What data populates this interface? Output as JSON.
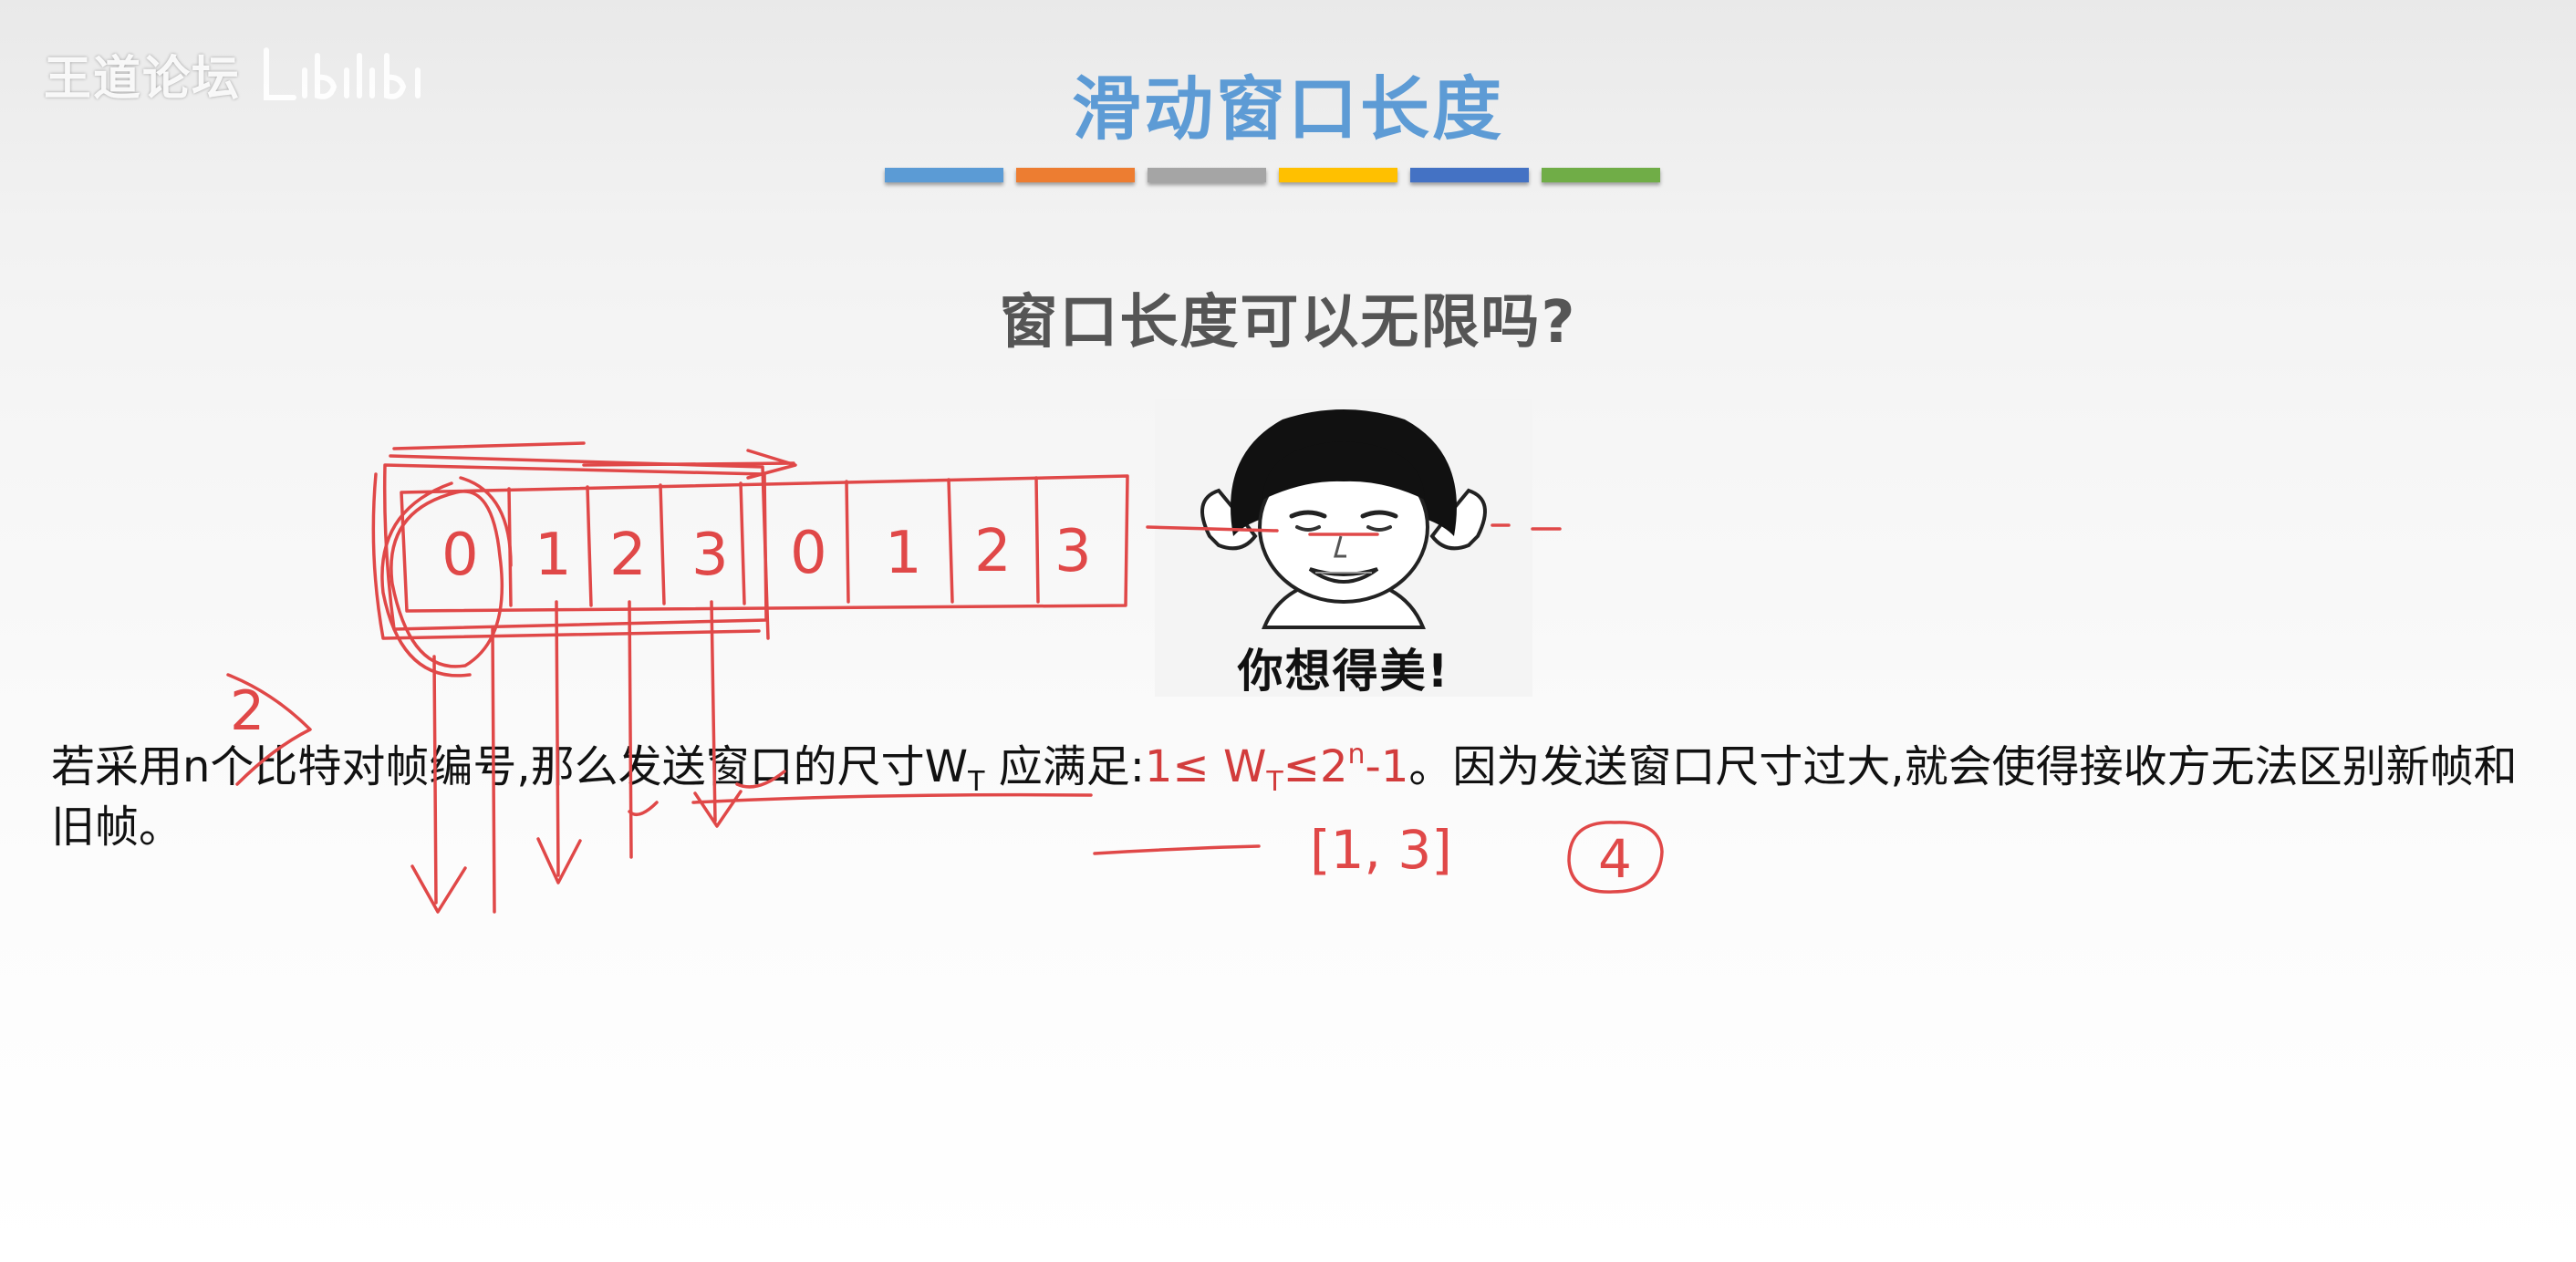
{
  "watermark": {
    "brand": "王道论坛"
  },
  "slide": {
    "title": "滑动窗口长度",
    "subtitle": "窗口长度可以无限吗?",
    "title_bar_colors": [
      "#5b9bd5",
      "#ed7d31",
      "#a5a5a5",
      "#ffc000",
      "#4472c4",
      "#70ad47"
    ]
  },
  "meme": {
    "caption": "你想得美!"
  },
  "body": {
    "text_part1": "若采用n个比特对帧编号,那么发送窗口的尺寸W",
    "sub_T1": "T",
    "text_part2": " 应满足:",
    "formula_part1": "1≤ W",
    "sub_T2": "T",
    "formula_part2": "≤2",
    "formula_sup_n": "n",
    "formula_part3": "-1",
    "text_part3": "。因为发送窗口尺寸过大,就会使得接收方无法区别新帧和旧帧。"
  },
  "annotations": {
    "cells": [
      "0",
      "1",
      "2",
      "3",
      "0",
      "1",
      "2",
      "3"
    ],
    "left_number": "2",
    "range_note": "[1, 3]",
    "circled_number": "4",
    "ink_color": "#e04848"
  }
}
